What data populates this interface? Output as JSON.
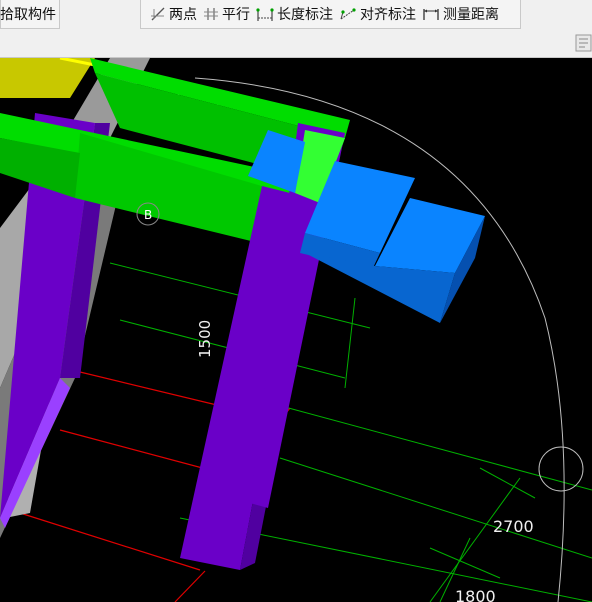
{
  "toolbar": {
    "pick_component": "拾取构件",
    "two_points": "两点",
    "parallel": "平行",
    "length_dimension": "长度标注",
    "aligned_dimension": "对齐标注",
    "measure_distance": "测量距离"
  },
  "viewport": {
    "dim_height": "1500",
    "dim_right_1": "2700",
    "dim_right_2": "1800",
    "axis_label": "B"
  },
  "colors": {
    "beam_green": "#00cc00",
    "column_purple": "#6a00c8",
    "panel_blue": "#0a84ff",
    "wall_gray": "#a6a6a6",
    "slab_yellow": "#c8c800",
    "axis_red": "#e00000",
    "grid_green": "#00b000"
  }
}
